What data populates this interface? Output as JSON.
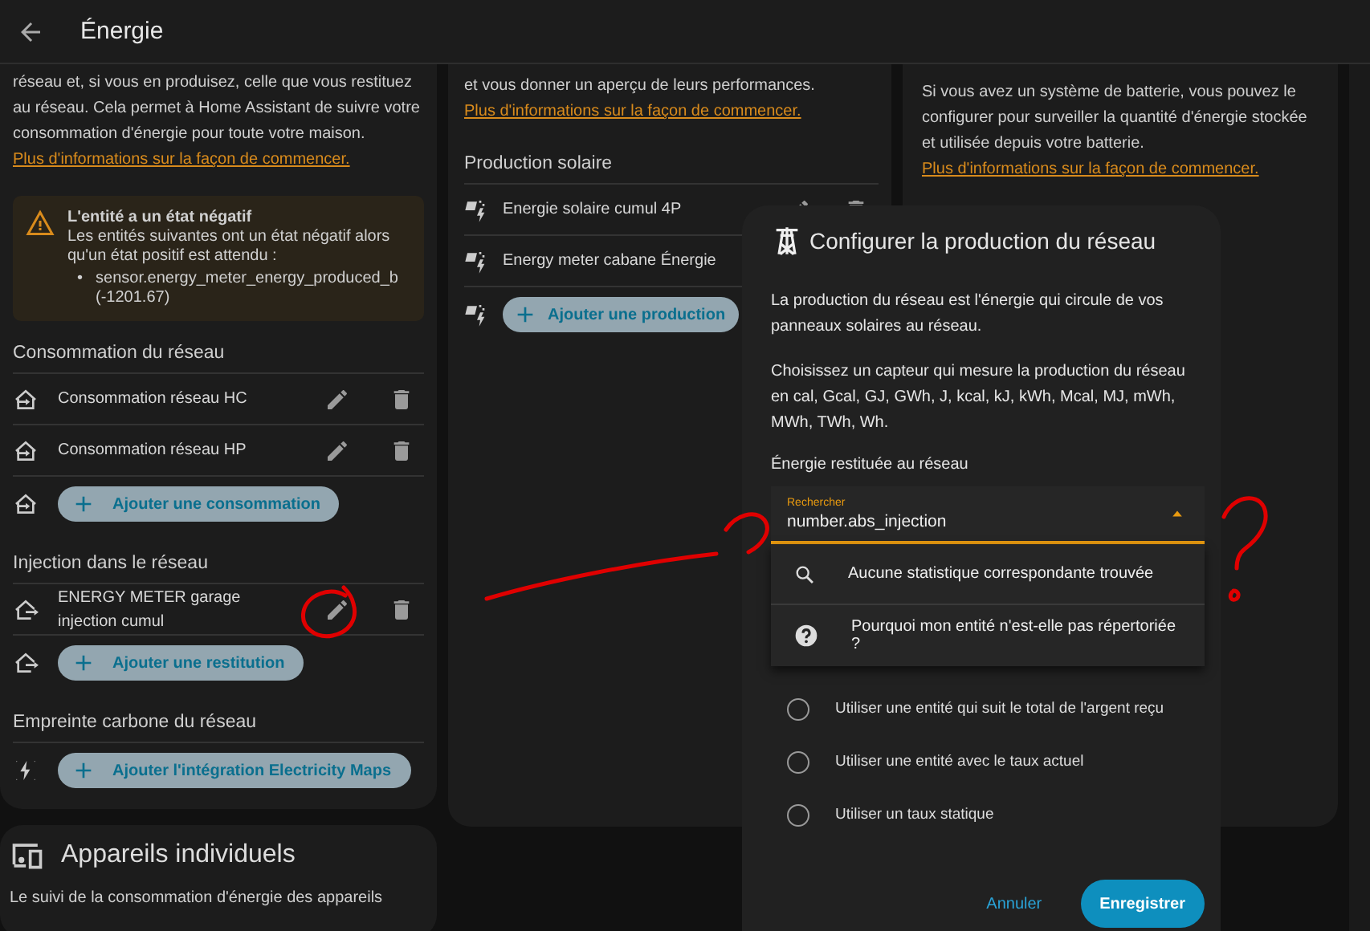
{
  "header": {
    "title": "Énergie"
  },
  "grid_card": {
    "intro": "réseau et, si vous en produisez, celle que vous restituez au réseau. Cela permet à Home Assistant de suivre votre consommation d'énergie pour toute votre maison.",
    "link": "Plus d'informations sur la façon de commencer.",
    "alert": {
      "title": "L'entité a un état négatif",
      "text": "Les entités suivantes ont un état négatif alors qu'un état positif est attendu :",
      "items": [
        {
          "marker": "•",
          "text": "sensor.energy_meter_energy_produced_b (-1201.67)"
        }
      ]
    },
    "sections": [
      {
        "kind": "import",
        "title": "Consommation du réseau",
        "entries": [
          {
            "label": "Consommation réseau HC"
          },
          {
            "label": "Consommation réseau HP"
          }
        ],
        "add_button": "Ajouter une consommation"
      },
      {
        "kind": "export",
        "title": "Injection dans le réseau",
        "entries": [
          {
            "label": "ENERGY METER garage injection cumul"
          }
        ],
        "add_button": "Ajouter une restitution"
      },
      {
        "kind": "carbon",
        "title": "Empreinte carbone du réseau",
        "add_button": "Ajouter l'intégration Electricity Maps"
      }
    ]
  },
  "solar_card": {
    "intro": "et vous donner un aperçu de leurs performances.",
    "link": "Plus d'informations sur la façon de commencer.",
    "section": {
      "kind": "solar",
      "title": "Production solaire",
      "entries": [
        {
          "label": "Energie solaire cumul 4P"
        },
        {
          "label": "Energy meter cabane Énergie"
        }
      ],
      "add_button": "Ajouter une production"
    }
  },
  "battery_card": {
    "intro": "Si vous avez un système de batterie, vous pouvez le configurer pour surveiller la quantité d'énergie stockée et utilisée depuis votre batterie.",
    "link": "Plus d'informations sur la façon de commencer."
  },
  "devices_card": {
    "title": "Appareils individuels",
    "text": "Le suivi de la consommation d'énergie des appareils"
  },
  "dialog": {
    "title": "Configurer la production du réseau",
    "paragraphs": [
      "La production du réseau est l'énergie qui circule de vos panneaux solaires au réseau.",
      "Choisissez un capteur qui mesure la production du réseau en cal, Gcal, GJ, GWh, J, kcal, kJ, kWh, Mcal, MJ, mWh, MWh, TWh, Wh."
    ],
    "field_label": "Énergie restituée au réseau",
    "combobox": {
      "label": "Rechercher",
      "value": "number.abs_injection",
      "expanded": true
    },
    "menu": [
      {
        "kind": "search",
        "text": "Aucune statistique correspondante trouvée"
      },
      {
        "kind": "help",
        "text": "Pourquoi mon entité n'est-elle pas répertoriée ?"
      }
    ],
    "radios": [
      {
        "label": "Utiliser une entité qui suit le total de l'argent reçu",
        "selected": false
      },
      {
        "label": "Utiliser une entité avec le taux actuel",
        "selected": false
      },
      {
        "label": "Utiliser un taux statique",
        "selected": false
      }
    ],
    "buttons": [
      {
        "kind": "text",
        "label": "Annuler"
      },
      {
        "kind": "filled",
        "label": "Enregistrer"
      }
    ]
  }
}
